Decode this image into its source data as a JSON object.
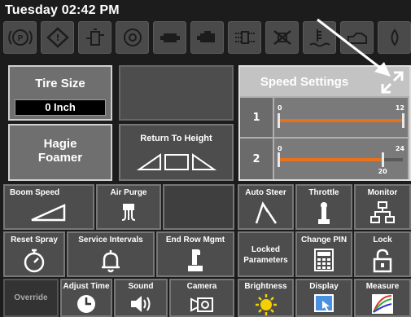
{
  "header": {
    "title": "Tuesday 02:42 PM"
  },
  "icon_bar": {
    "items": [
      {
        "name": "parking-brake-icon"
      },
      {
        "name": "warning-diamond-icon"
      },
      {
        "name": "fuel-filter-icon"
      },
      {
        "name": "fan-icon"
      },
      {
        "name": "engine-icon"
      },
      {
        "name": "engine-alt-icon"
      },
      {
        "name": "hydraulic-icon"
      },
      {
        "name": "filter-cross-icon"
      },
      {
        "name": "coolant-level-icon"
      },
      {
        "name": "oil-can-icon"
      },
      {
        "name": "oil-drop-icon"
      }
    ]
  },
  "tiles": {
    "tire_size": {
      "label": "Tire Size",
      "value": "0 Inch"
    },
    "hagie_foamer": {
      "label_line1": "Hagie",
      "label_line2": "Foamer"
    },
    "return_to_height": {
      "label": "Return To Height"
    },
    "boom_speed": {
      "label": "Boom Speed"
    },
    "air_purge": {
      "label": "Air Purge"
    },
    "auto_steer": {
      "label": "Auto Steer"
    },
    "throttle": {
      "label": "Throttle"
    },
    "monitor": {
      "label": "Monitor"
    },
    "reset_spray": {
      "label": "Reset Spray"
    },
    "service_intervals": {
      "label": "Service Intervals"
    },
    "end_row_mgmt": {
      "label": "End Row Mgmt"
    },
    "locked_parameters": {
      "label_line1": "Locked",
      "label_line2": "Parameters"
    },
    "change_pin": {
      "label": "Change PIN"
    },
    "lock": {
      "label": "Lock"
    },
    "override": {
      "label": "Override"
    },
    "adjust_time": {
      "label": "Adjust Time"
    },
    "sound": {
      "label": "Sound"
    },
    "camera": {
      "label": "Camera"
    },
    "brightness": {
      "label": "Brightness"
    },
    "display": {
      "label": "Display"
    },
    "measure": {
      "label": "Measure"
    }
  },
  "speed_settings": {
    "title": "Speed Settings",
    "slider1": {
      "index": "1",
      "min": "0",
      "max": "12"
    },
    "slider2": {
      "index": "2",
      "min": "0",
      "max": "24",
      "value": "20",
      "fraction": 0.833
    }
  },
  "colors": {
    "accent": "#e8711d",
    "tile": "#4d4d4d",
    "tile_light": "#6f6f6f"
  }
}
